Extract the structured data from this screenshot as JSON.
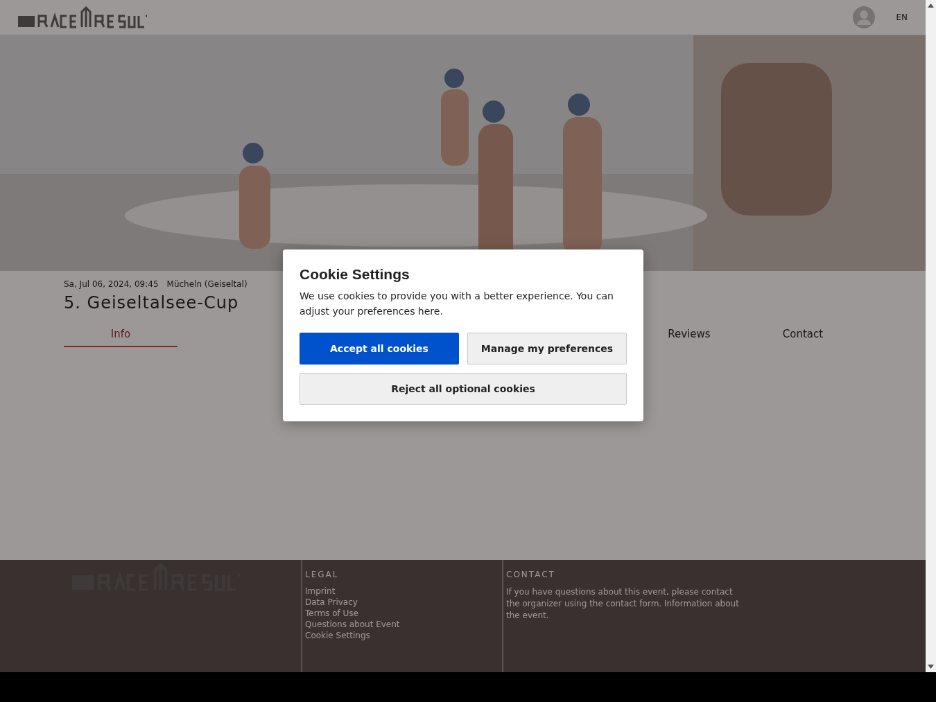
{
  "header": {
    "language": "EN"
  },
  "event": {
    "date": "Sa, Jul 06, 2024, 09:45",
    "location": "Mücheln (Geiseltal)",
    "title": "5. Geiseltalsee-Cup"
  },
  "tabs": [
    {
      "label": "Info",
      "selected": true
    },
    {
      "label": "Reviews",
      "selected": false
    },
    {
      "label": "Contact",
      "selected": false
    }
  ],
  "footer": {
    "legal_heading": "LEGAL",
    "legal_links": [
      "Imprint",
      "Data Privacy",
      "Terms of Use",
      "Questions about Event",
      "Cookie Settings"
    ],
    "contact_heading": "CONTACT",
    "contact_text": "If you have questions about this event, please contact the organizer using the contact form. Information about the event."
  },
  "cookie_dialog": {
    "title": "Cookie Settings",
    "text": "We use cookies to provide you with a better experience. You can adjust your preferences here.",
    "buttons": [
      {
        "label": "Accept all cookies",
        "kind": "primary"
      },
      {
        "label": "Manage my preferences",
        "kind": "secondary"
      },
      {
        "label": "Reject all optional cookies",
        "kind": "wide"
      }
    ]
  }
}
